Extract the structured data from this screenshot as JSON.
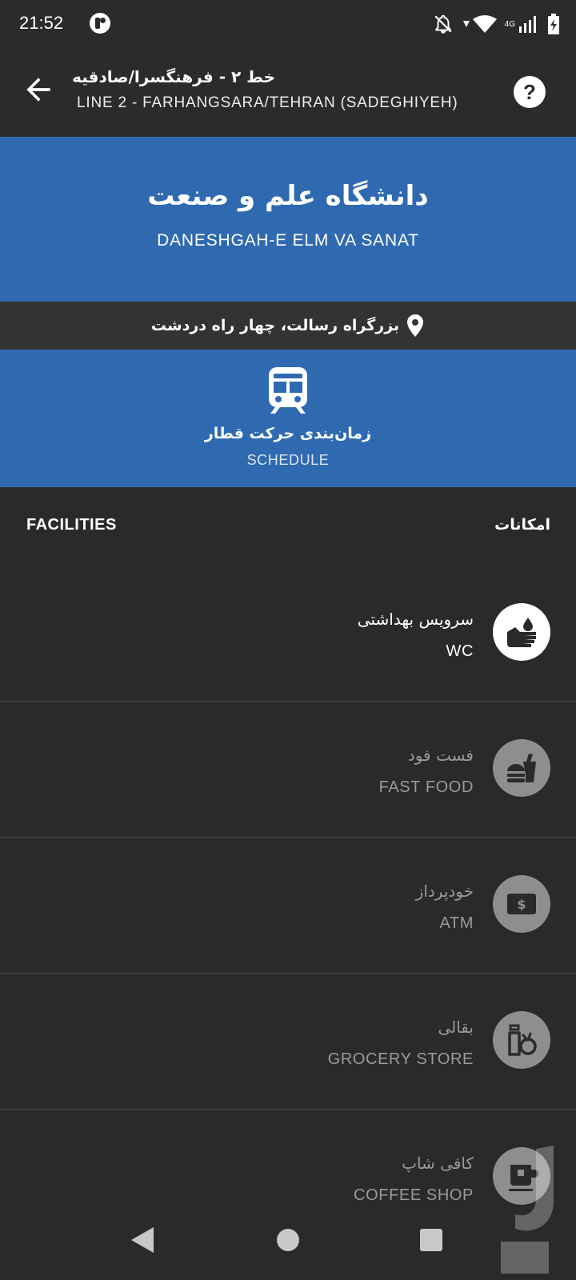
{
  "status_bar": {
    "time": "21:52",
    "network": "4G",
    "icons": [
      "app-notification-icon",
      "notifications-off-icon",
      "wifi-icon",
      "signal-icon",
      "battery-charging-icon"
    ]
  },
  "toolbar": {
    "title_fa": "خط ۲ - فرهنگسرا/صادقیه",
    "title_en": "LINE 2 - FARHANGSARA/TEHRAN (SADEGHIYEH)",
    "help_label": "?",
    "icons": [
      "arrow-back-icon",
      "help-icon"
    ]
  },
  "station": {
    "name_fa": "دانشگاه علم و صنعت",
    "name_en": "DANESHGAH-E ELM VA SANAT",
    "address_fa": "بزرگراه رسالت، چهار راه دردشت",
    "address_icon": "location-pin-icon"
  },
  "schedule": {
    "label_fa": "زمان‌بندی حرکت قطار",
    "label_en": "SCHEDULE",
    "icon": "train-icon"
  },
  "facilities": {
    "header_en": "FACILITIES",
    "header_fa": "امکانات",
    "items": [
      {
        "name_fa": "سرویس بهداشتی",
        "name_en": "WC",
        "icon": "hand-wash-icon",
        "available": true
      },
      {
        "name_fa": "فست فود",
        "name_en": "FAST FOOD",
        "icon": "fast-food-icon",
        "available": false
      },
      {
        "name_fa": "خودپرداز",
        "name_en": "ATM",
        "icon": "atm-icon",
        "available": false
      },
      {
        "name_fa": "بقالی",
        "name_en": "GROCERY STORE",
        "icon": "grocery-icon",
        "available": false
      },
      {
        "name_fa": "کافی شاپ",
        "name_en": "COFFEE SHOP",
        "icon": "coffee-icon",
        "available": false
      }
    ]
  },
  "colors": {
    "accent_blue": "#2f6ab1",
    "background": "#2a2a2a",
    "toolbar": "#2b2b2b",
    "inactive_icon": "#8e8e8e"
  }
}
